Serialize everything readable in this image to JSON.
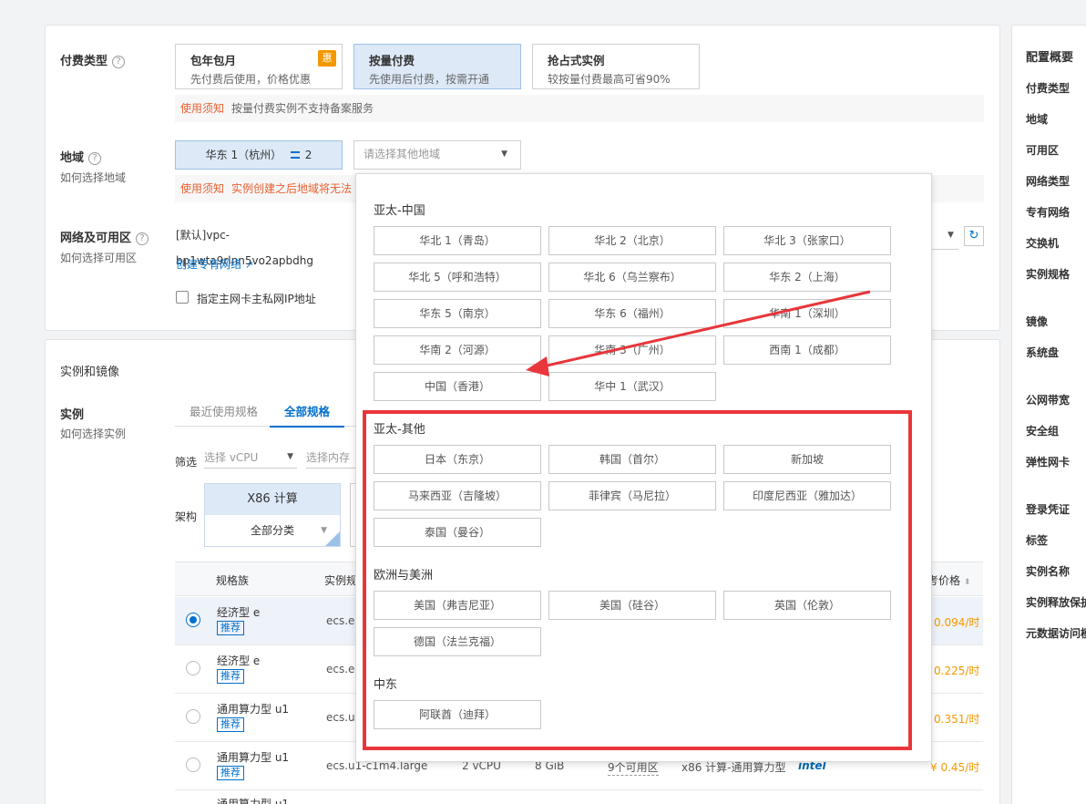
{
  "billing": {
    "label": "付费类型",
    "help": "?",
    "options": [
      {
        "title": "包年包月",
        "desc": "先付费后使用，价格优惠",
        "badge": "惠"
      },
      {
        "title": "按量付费",
        "desc": "先使用后付费，按需开通"
      },
      {
        "title": "抢占式实例",
        "desc": "较按量付费最高可省90%"
      }
    ],
    "notice_tag": "使用须知",
    "notice_msg": "按量付费实例不支持备案服务"
  },
  "region": {
    "label": "地域",
    "help": "?",
    "sub": "如何选择地域",
    "selected": "华东 1（杭州）",
    "selected_count": "2",
    "other_placeholder": "请选择其他地域",
    "notice_tag": "使用须知",
    "notice_msg": "实例创建之后地域将无法"
  },
  "network": {
    "label": "网络及可用区",
    "help": "?",
    "sub": "如何选择可用区",
    "vpc_value": "[默认]vpc-bp1wta9rlnn5vo2apbdhg",
    "create_vpc_link": "创建专有网络",
    "private_ip_label": "指定主网卡主私网IP地址"
  },
  "instance_section": {
    "title": "实例和镜像",
    "instance_label": "实例",
    "instance_sub": "如何选择实例",
    "tabs": [
      "最近使用规格",
      "全部规格"
    ],
    "filter_label": "筛选",
    "filter_cpu": "选择 vCPU",
    "filter_mem": "选择内存",
    "arch_label": "架构",
    "arch_name": "X86 计算",
    "arch_category": "全部分类",
    "table_headers": [
      "规格族",
      "实例规",
      "考价格"
    ],
    "rows": [
      {
        "family": "经济型 e",
        "tag": "推荐",
        "spec": "ecs.e-",
        "price": "0.094/时"
      },
      {
        "family": "经济型 e",
        "tag": "推荐",
        "spec": "ecs.e-",
        "price": "0.225/时"
      },
      {
        "family": "通用算力型 u1",
        "tag": "推荐",
        "spec": "ecs.u1",
        "price": "0.351/时"
      },
      {
        "family": "通用算力型 u1",
        "tag": "推荐",
        "spec": "ecs.u1-c1m4.large",
        "vcpu": "2 vCPU",
        "mem": "8 GiB",
        "zones": "9个可用区",
        "arch": "x86 计算-通用算力型",
        "brand": "intel",
        "price": "¥ 0.45/时"
      },
      {
        "family": "通用算力型 u1"
      }
    ]
  },
  "sidebar": {
    "items": [
      "配置概要",
      "付费类型",
      "地域",
      "可用区",
      "网络类型",
      "专有网络",
      "交换机",
      "实例规格",
      "镜像",
      "系统盘",
      "公网带宽",
      "安全组",
      "弹性网卡",
      "登录凭证",
      "标签",
      "实例名称",
      "实例释放保护",
      "元数据访问模"
    ]
  },
  "dropdown": {
    "groups": [
      {
        "title": "亚太-中国",
        "regions": [
          "华北 1（青岛）",
          "华北 2（北京）",
          "华北 3（张家口）",
          "华北 5（呼和浩特）",
          "华北 6（乌兰察布）",
          "华东 2（上海）",
          "华东 5（南京）",
          "华东 6（福州）",
          "华南 1（深圳）",
          "华南 2（河源）",
          "华南 3（广州）",
          "西南 1（成都）",
          "中国（香港）",
          "华中 1（武汉）"
        ]
      },
      {
        "title": "亚太-其他",
        "regions": [
          "日本（东京）",
          "韩国（首尔）",
          "新加坡",
          "马来西亚（吉隆坡）",
          "菲律宾（马尼拉）",
          "印度尼西亚（雅加达）",
          "泰国（曼谷）"
        ]
      },
      {
        "title": "欧洲与美洲",
        "regions": [
          "美国（弗吉尼亚）",
          "美国（硅谷）",
          "英国（伦敦）",
          "德国（法兰克福）"
        ]
      },
      {
        "title": "中东",
        "regions": [
          "阿联酋（迪拜）"
        ]
      }
    ]
  },
  "colors": {
    "accent": "#0070cc",
    "highlight": "#e8363c",
    "warning": "#e8612f",
    "price": "#f39800"
  }
}
